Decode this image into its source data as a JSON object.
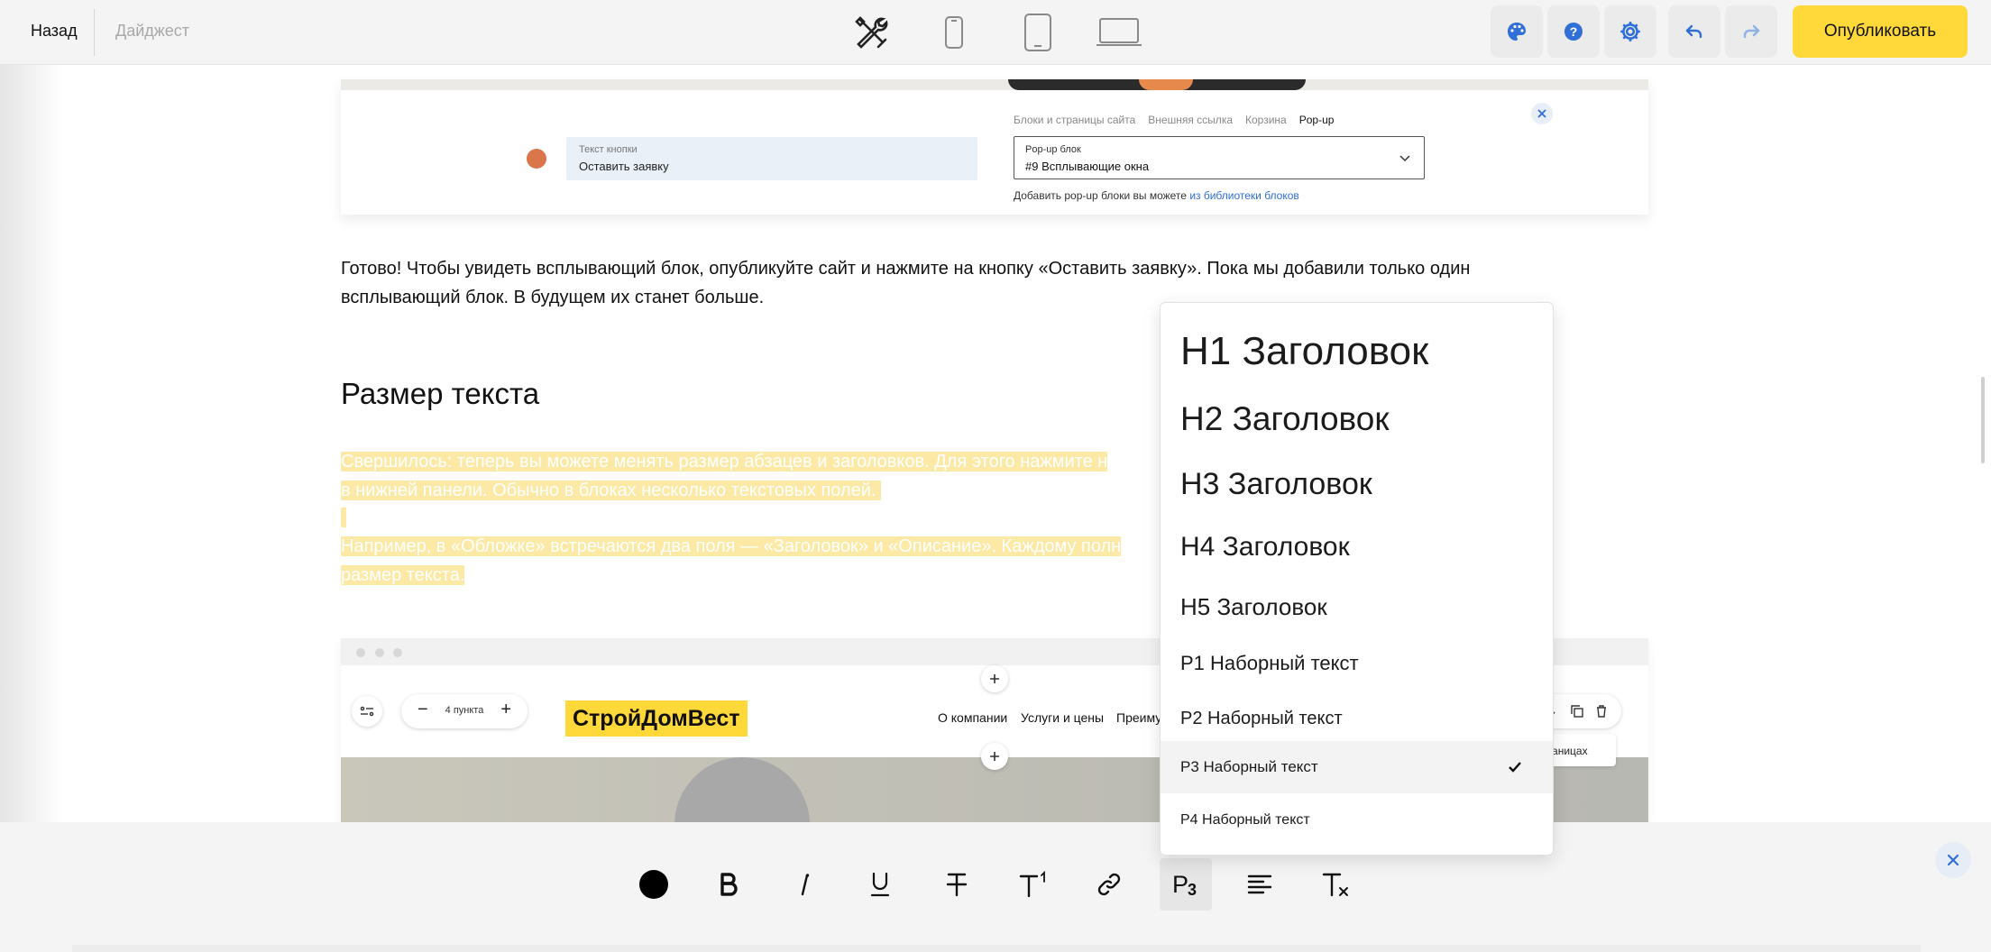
{
  "topbar": {
    "back_label": "Назад",
    "digest_label": "Дайджест",
    "publish_label": "Опубликовать",
    "icons": [
      "tools-icon",
      "phone-icon",
      "tablet-icon",
      "laptop-icon",
      "palette-icon",
      "help-icon",
      "gear-icon",
      "undo-icon",
      "redo-icon"
    ],
    "accent_color": "#ffd83a",
    "icon_color": "#2f6fd6"
  },
  "screenshot_top": {
    "button_text_label": "Текст кнопки",
    "button_text_value": "Оставить заявку",
    "link_tabs": [
      "Блоки и страницы сайта",
      "Внешняя ссылка",
      "Корзина",
      "Pop-up"
    ],
    "active_tab": "Pop-up",
    "popup_label": "Pop-up блок",
    "popup_value": "#9 Всплывающие окна",
    "note_prefix": "Добавить pop-up блоки вы можете",
    "note_link": "из библиотеки блоков"
  },
  "article": {
    "paragraph1_line1": "Готово! Чтобы увидеть всплывающий блок, опубликуйте сайт и нажмите на кнопку «Оставить заявку». Пока мы добавили только один",
    "paragraph1_line2": "всплывающий блок. В будущем их станет больше.",
    "heading": "Размер текста",
    "selected_line1": "Свершилось: теперь вы можете менять размер абзацев и заголовков. Для этого нажмите н",
    "selected_line2": "в нижней панели. Обычно в блоках несколько текстовых полей.",
    "selected_line3": "Например, в «Обложке» встречаются два поля — «Заголовок» и «Описание». Каждому полн",
    "selected_line4": "размер текста.",
    "selection_color": "#fde9a6"
  },
  "screenshot_bottom": {
    "stepper_value": "4 пункта",
    "logo_text": "СтройДомВест",
    "nav": [
      "О компании",
      "Услуги и цены",
      "Преиму"
    ],
    "tooltip_fragment": "границах"
  },
  "text_size_dropdown": {
    "items": [
      {
        "label": "H1 Заголовок"
      },
      {
        "label": "H2 Заголовок"
      },
      {
        "label": "H3 Заголовок"
      },
      {
        "label": "H4 Заголовок"
      },
      {
        "label": "H5 Заголовок"
      },
      {
        "label": "P1 Наборный текст"
      },
      {
        "label": "P2 Наборный текст"
      },
      {
        "label": "P3 Наборный текст",
        "selected": true
      },
      {
        "label": "P4 Наборный текст"
      }
    ]
  },
  "bottom_toolbar": {
    "tools": [
      "color-icon",
      "bold-icon",
      "italic-icon",
      "underline-icon",
      "strikethrough-icon",
      "superscript-icon",
      "link-icon",
      "text-size-icon",
      "align-left-icon",
      "clear-format-icon",
      "close-icon"
    ],
    "text_size_glyph": "P",
    "text_size_sub": "3",
    "superscript_glyph": "1"
  }
}
